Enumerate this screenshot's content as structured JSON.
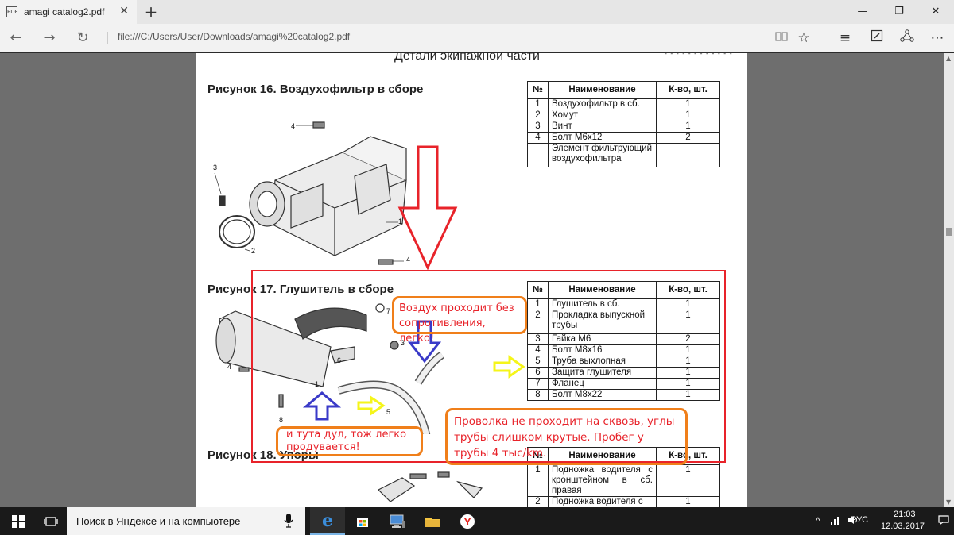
{
  "browser": {
    "tab_title": "amagi catalog2.pdf",
    "tab_icon_label": "PDF",
    "address": "file:///C:/Users/User/Downloads/amagi%20catalog2.pdf"
  },
  "document": {
    "heading": "Детали экипажной части",
    "header_mark": "- - - - - - - - - - - -",
    "table_headers": {
      "num": "№",
      "name": "Наименование",
      "qty": "К-во, шт."
    },
    "fig16": {
      "title": "Рисунок  16. Воздухофильтр в сборе",
      "rows": [
        {
          "num": "1",
          "name": "Воздухофильтр в сб.",
          "qty": "1"
        },
        {
          "num": "2",
          "name": "Хомут",
          "qty": "1"
        },
        {
          "num": "3",
          "name": "Винт",
          "qty": "1"
        },
        {
          "num": "4",
          "name": "Болт М6х12",
          "qty": "2"
        },
        {
          "num": "",
          "name": "Элемент фильтрующий воздухофильтра",
          "qty": ""
        }
      ],
      "callouts": [
        "1",
        "2",
        "3",
        "4",
        "4"
      ]
    },
    "fig17": {
      "title": "Рисунок  17. Глушитель в сборе",
      "rows": [
        {
          "num": "1",
          "name": "Глушитель в сб.",
          "qty": "1"
        },
        {
          "num": "2",
          "name": "Прокладка выпускной трубы",
          "qty": "1"
        },
        {
          "num": "3",
          "name": "Гайка М6",
          "qty": "2"
        },
        {
          "num": "4",
          "name": "Болт М8х16",
          "qty": "1"
        },
        {
          "num": "5",
          "name": "Труба выхлопная",
          "qty": "1"
        },
        {
          "num": "6",
          "name": "Защита глушителя",
          "qty": "1"
        },
        {
          "num": "7",
          "name": "Фланец",
          "qty": "1"
        },
        {
          "num": "8",
          "name": "Болт М8х22",
          "qty": "1"
        }
      ],
      "callouts": [
        "1",
        "3",
        "4",
        "5",
        "6",
        "7",
        "8"
      ]
    },
    "fig18": {
      "title": "Рисунок  18. Упоры",
      "rows": [
        {
          "num": "1",
          "name": "Подножка водителя с кронштейном в сб. правая",
          "qty": "1"
        },
        {
          "num": "2",
          "name": "Подножка водителя с",
          "qty": "1"
        }
      ]
    }
  },
  "annotations": {
    "bubble_air": "Воздух проходит без сопротивления, легко!",
    "bubble_blow": "и тута  дул, тож легко продувается!",
    "bubble_wire": "Проволка не проходит на сквозь, углы трубы слишком крутые. Пробег у трубы 4 тыс/km.",
    "colors": {
      "red": "#e8232a",
      "orange": "#f07f1a",
      "blue": "#3a3ac8",
      "yellow": "#f5f51a"
    }
  },
  "taskbar": {
    "search_text": "Поиск в Яндексе и на компьютере",
    "language": "РУС",
    "time": "21:03",
    "date": "12.03.2017"
  }
}
